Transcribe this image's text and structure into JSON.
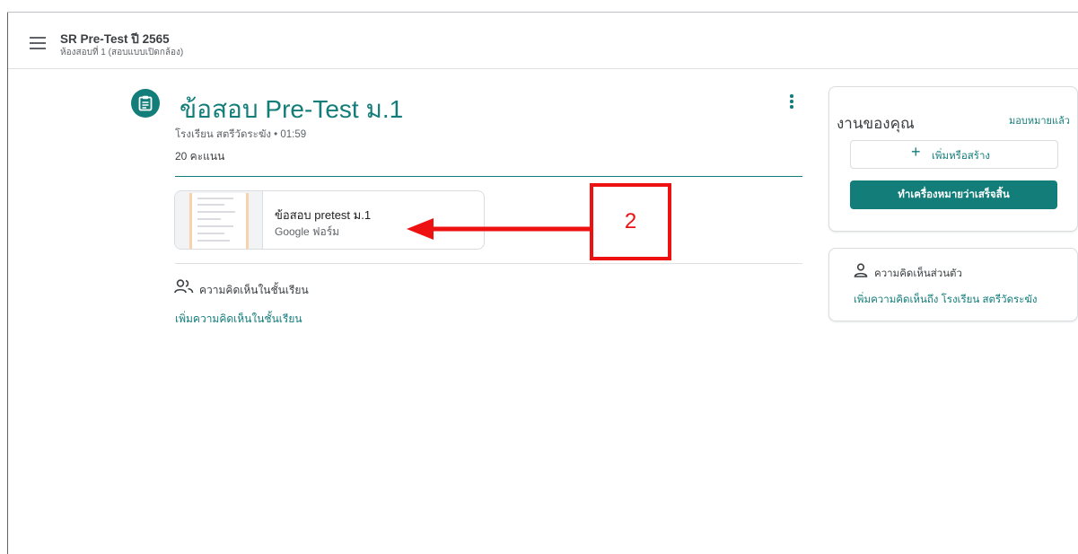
{
  "header": {
    "title": "SR Pre-Test ปี 2565",
    "subtitle": "ห้องสอบที่ 1 (สอบแบบเปิดกล้อง)"
  },
  "assignment": {
    "title": "ข้อสอบ Pre-Test ม.1",
    "meta": "โรงเรียน สตรีวัดระฆัง • 01:59",
    "points": "20 คะแนน"
  },
  "attachment": {
    "name": "ข้อสอบ pretest ม.1",
    "type": "Google ฟอร์ม"
  },
  "class_comments": {
    "label": "ความคิดเห็นในชั้นเรียน",
    "add_link": "เพิ่มความคิดเห็นในชั้นเรียน"
  },
  "your_work": {
    "heading": "งานของคุณ",
    "status": "มอบหมายแล้ว",
    "add_button": "เพิ่มหรือสร้าง",
    "add_button_icon": "+",
    "mark_done_button": "ทำเครื่องหมายว่าเสร็จสิ้น"
  },
  "private_comments": {
    "heading": "ความคิดเห็นส่วนตัว",
    "add_link": "เพิ่มความคิดเห็นถึง โรงเรียน สตรีวัดระฆัง"
  },
  "annotation": {
    "label": "2",
    "color": "#ee1111"
  },
  "colors": {
    "accent": "#137d7a"
  },
  "icons": [
    "menu-icon",
    "assignment-icon",
    "more-vert-icon",
    "people-icon",
    "person-icon"
  ]
}
